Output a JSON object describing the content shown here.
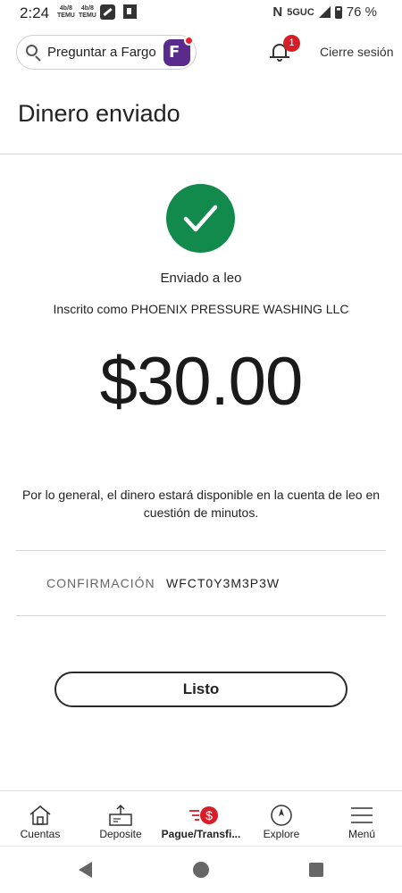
{
  "status_bar": {
    "time": "2:24",
    "temu_label": "TEMU",
    "network": "5GUC",
    "battery": "76 %"
  },
  "header": {
    "search_label": "Preguntar a Fargo",
    "notification_count": "1",
    "logout_label": "Cierre sesión"
  },
  "page": {
    "title": "Dinero enviado"
  },
  "result": {
    "sent_to": "Enviado a leo",
    "enrolled_as": "Inscrito como PHOENIX PRESSURE WASHING LLC",
    "amount": "$30.00",
    "availability_note": "Por lo general, el dinero estará disponible en la cuenta de leo en cuestión de minutos.",
    "confirmation_label": "CONFIRMACIÓN",
    "confirmation_value": "WFCT0Y3M3P3W"
  },
  "actions": {
    "done_label": "Listo"
  },
  "bottom_nav": {
    "items": [
      {
        "label": "Cuentas",
        "icon": "house-icon"
      },
      {
        "label": "Deposite",
        "icon": "deposit-icon"
      },
      {
        "label": "Pague/Transfi...",
        "icon": "pay-transfer-icon"
      },
      {
        "label": "Explore",
        "icon": "compass-icon"
      },
      {
        "label": "Menú",
        "icon": "hamburger-menu-icon"
      }
    ],
    "active_index": 2
  },
  "colors": {
    "success_green": "#128a4c",
    "brand_red": "#d71e28",
    "fargo_purple": "#5a2a8c"
  }
}
